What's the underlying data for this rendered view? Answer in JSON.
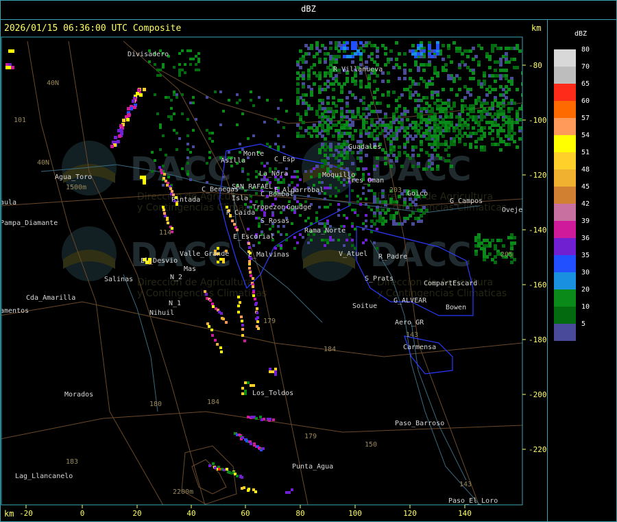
{
  "header": {
    "title": "dBZ"
  },
  "map": {
    "timestamp": "2026/01/15 06:36:00 UTC Composite",
    "unit_km": "km",
    "x_ticks": [
      "-20",
      "0",
      "20",
      "40",
      "60",
      "80",
      "100",
      "120",
      "140"
    ],
    "y_ticks": [
      "-80",
      "-100",
      "-120",
      "-140",
      "-160",
      "-180",
      "-200",
      "-220"
    ],
    "towns": [
      "Divisadero",
      "R_Villanueva",
      "40N",
      "101",
      "Guadales",
      "Monte",
      "Asilla",
      "C_Esp",
      "Moquillo",
      "Tres_Oman",
      "Agua_Toro",
      "1500m",
      "La_Nora",
      "C_Benegas",
      "SAN_RAFAEL",
      "E_Algarrobal",
      "203",
      "Goico",
      "G_Campos",
      "Ovejero",
      "aula",
      "Pampa_Diamante",
      "Pintada",
      "Isla",
      "C_Bombal",
      "Tropezon",
      "Goudge",
      "R_Caida",
      "S_Rosas",
      "Rama_Norte",
      "E_Escorial",
      "Valle_Grande",
      "L_Malvinas",
      "V_Atuel",
      "R_Padre",
      "El_Desvio",
      "Salinas",
      "N_2",
      "S_Prats",
      "CompartEscard",
      "Cda_Amarilla",
      "N_1",
      "Nihuil",
      "Soitue",
      "G_ALVEAR",
      "Bowen",
      "amentos",
      "Aero_GR",
      "143",
      "Carmensa",
      "179",
      "184",
      "Morados",
      "180",
      "Los_Toldos",
      "184",
      "Paso_Barroso",
      "179",
      "150",
      "183",
      "Punta_Agua",
      "Lag_Llancanelo",
      "2200m",
      "143",
      "Paso_El_Loro",
      "205",
      "40N",
      "114",
      "Mas"
    ],
    "watermark": {
      "brand": "DACC",
      "line1": "Direccion de Agricultura",
      "line2": "y Contingencias Climaticas"
    }
  },
  "legend": {
    "title": "dBZ",
    "entries": [
      {
        "label": "80",
        "color": "#d8d8d8"
      },
      {
        "label": "70",
        "color": "#bdbdbd"
      },
      {
        "label": "65",
        "color": "#ff2b1a"
      },
      {
        "label": "60",
        "color": "#ff6a00"
      },
      {
        "label": "57",
        "color": "#ff9a5a"
      },
      {
        "label": "54",
        "color": "#ffff00"
      },
      {
        "label": "51",
        "color": "#ffd02a"
      },
      {
        "label": "48",
        "color": "#f0b030"
      },
      {
        "label": "45",
        "color": "#d08030"
      },
      {
        "label": "42",
        "color": "#c870a0"
      },
      {
        "label": "39",
        "color": "#d01a9c"
      },
      {
        "label": "36",
        "color": "#7020d0"
      },
      {
        "label": "35",
        "color": "#2050ff"
      },
      {
        "label": "30",
        "color": "#1a90e0"
      },
      {
        "label": "20",
        "color": "#0a8a18"
      },
      {
        "label": "10",
        "color": "#046a10"
      },
      {
        "label": "5",
        "color": "#4a4a9a"
      }
    ]
  }
}
